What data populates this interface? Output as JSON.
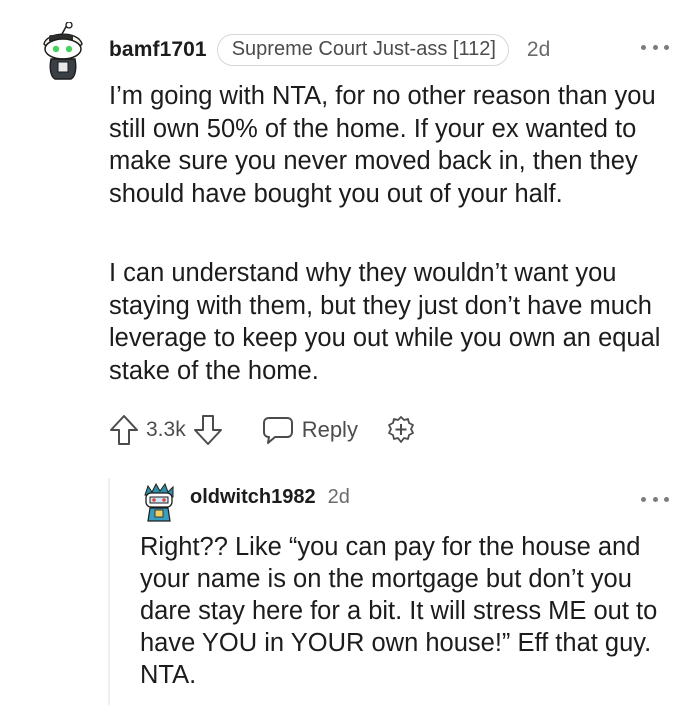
{
  "comment": {
    "username": "bamf1701",
    "flair": "Supreme Court Just-ass [112]",
    "time": "2d",
    "paragraphs": [
      "I’m going with NTA, for no other reason than you still own 50% of the home. If your ex wanted to make sure you never moved back in, then they should have bought you out of your half.",
      "I can understand why they wouldn’t want you staying with them, but they just don’t have much leverage to keep you out while you own an equal stake of the home."
    ],
    "score": "3.3k",
    "reply_label": "Reply",
    "icons": {
      "upvote": "upvote-arrow-icon",
      "downvote": "downvote-arrow-icon",
      "reply": "speech-bubble-icon",
      "award": "award-plus-icon",
      "more": "more-dots-icon"
    }
  },
  "reply": {
    "username": "oldwitch1982",
    "time": "2d",
    "text": "Right?? Like “you can pay for the house and your name is on the mortgage but don’t you dare stay here for a bit. It will stress ME out to have YOU in YOUR own house!” Eff that guy. NTA."
  },
  "colors": {
    "text": "#1c1c1c",
    "meta": "#6a6a6a",
    "icon": "#4c4c4c",
    "thread_line": "#edeff1"
  }
}
